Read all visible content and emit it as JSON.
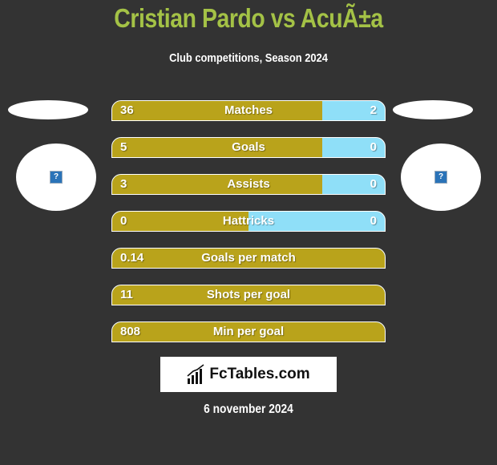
{
  "header": {
    "title": "Cristian Pardo vs AcuÃ±a",
    "subtitle": "Club competitions, Season 2024"
  },
  "players": {
    "left": {
      "logo_icon": "broken-image-icon",
      "logo_glyph": "?"
    },
    "right": {
      "logo_icon": "broken-image-icon",
      "logo_glyph": "?"
    }
  },
  "colors": {
    "title": "#a4c246",
    "left_bar": "#b9a31b",
    "right_bar": "#8fdff8",
    "background": "#333333"
  },
  "stats": [
    {
      "label": "Matches",
      "left": "36",
      "right": "2",
      "left_share": 0.77
    },
    {
      "label": "Goals",
      "left": "5",
      "right": "0",
      "left_share": 0.77
    },
    {
      "label": "Assists",
      "left": "3",
      "right": "0",
      "left_share": 0.77
    },
    {
      "label": "Hattricks",
      "left": "0",
      "right": "0",
      "left_share": 0.5
    },
    {
      "label": "Goals per match",
      "left": "0.14",
      "right": null,
      "left_share": 1.0
    },
    {
      "label": "Shots per goal",
      "left": "11",
      "right": null,
      "left_share": 1.0
    },
    {
      "label": "Min per goal",
      "left": "808",
      "right": null,
      "left_share": 1.0
    }
  ],
  "footer": {
    "brand": "FcTables.com",
    "brand_icon": "bar-chart-icon",
    "date": "6 november 2024"
  }
}
